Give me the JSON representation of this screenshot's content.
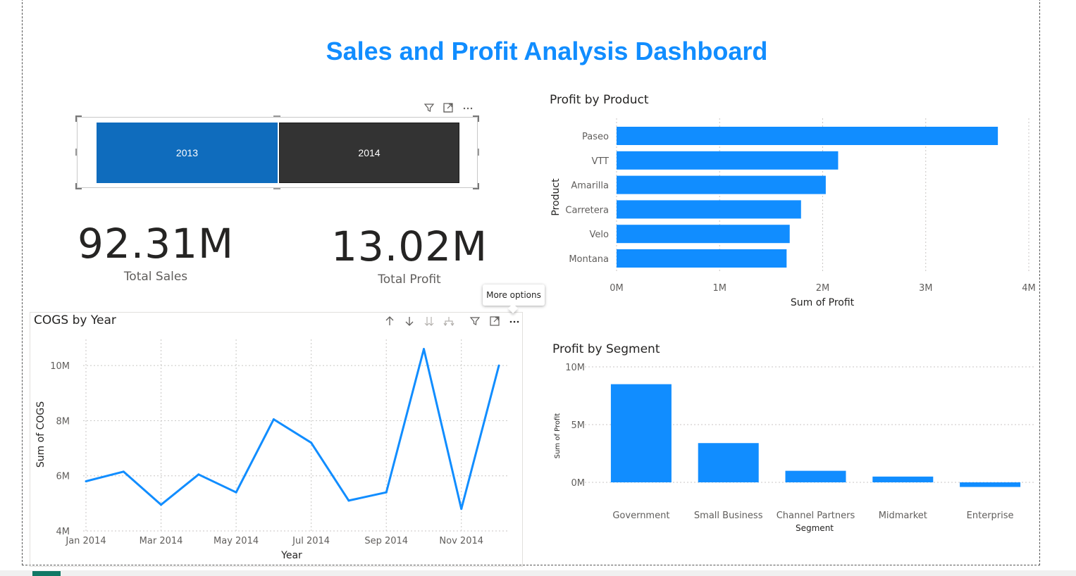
{
  "dashboard": {
    "title": "Sales and Profit Analysis Dashboard"
  },
  "slicer": {
    "items": [
      {
        "label": "2013",
        "selected": true
      },
      {
        "label": "2014",
        "selected": false
      }
    ]
  },
  "cards": {
    "total_sales": {
      "value": "92.31M",
      "label": "Total Sales"
    },
    "total_profit": {
      "value": "13.02M",
      "label": "Total Profit"
    }
  },
  "tooltip": {
    "text": "More options"
  },
  "visual_header_icons": [
    "filter-icon",
    "focus-mode-icon",
    "more-options-icon"
  ],
  "cogs_header_icons": [
    "drill-up-icon",
    "drill-down-icon",
    "expand-all-icon",
    "expand-hierarchy-icon",
    "filter-icon",
    "focus-mode-icon",
    "more-options-icon"
  ],
  "colors": {
    "accent": "#118dff",
    "slicer_selected": "#0f6cbd",
    "slicer_unselected": "#333333"
  },
  "chart_data": [
    {
      "type": "bar",
      "orientation": "horizontal",
      "title": "Profit by Product",
      "xlabel": "Sum of Profit",
      "ylabel": "Product",
      "categories": [
        "Paseo",
        "VTT",
        "Amarilla",
        "Carretera",
        "Velo",
        "Montana"
      ],
      "values": [
        3700000,
        2150000,
        2030000,
        1790000,
        1680000,
        1650000
      ],
      "xlim": [
        0,
        4000000
      ],
      "ticks": [
        "0M",
        "1M",
        "2M",
        "3M",
        "4M"
      ],
      "grid": true
    },
    {
      "type": "line",
      "title": "COGS by Year",
      "xlabel": "Year",
      "ylabel": "Sum of COGS",
      "x": [
        "Jan 2014",
        "Feb 2014",
        "Mar 2014",
        "Apr 2014",
        "May 2014",
        "Jun 2014",
        "Jul 2014",
        "Aug 2014",
        "Sep 2014",
        "Oct 2014",
        "Nov 2014",
        "Dec 2014"
      ],
      "x_tick_labels": [
        "Jan 2014",
        "Mar 2014",
        "May 2014",
        "Jul 2014",
        "Sep 2014",
        "Nov 2014"
      ],
      "values": [
        5800000,
        6150000,
        4950000,
        6050000,
        5400000,
        8050000,
        7200000,
        5100000,
        5400000,
        10600000,
        4800000,
        10000000
      ],
      "ylim": [
        4000000,
        11000000
      ],
      "y_ticks": [
        "4M",
        "6M",
        "8M",
        "10M"
      ],
      "grid": true
    },
    {
      "type": "bar",
      "orientation": "vertical",
      "title": "Profit by Segment",
      "xlabel": "Segment",
      "ylabel": "Sum of Profit",
      "categories": [
        "Government",
        "Small Business",
        "Channel Partners",
        "Midmarket",
        "Enterprise"
      ],
      "values": [
        8500000,
        3400000,
        1000000,
        500000,
        -400000
      ],
      "ylim": [
        -1000000,
        10000000
      ],
      "y_ticks": [
        "0M",
        "5M",
        "10M"
      ],
      "grid": true
    }
  ]
}
